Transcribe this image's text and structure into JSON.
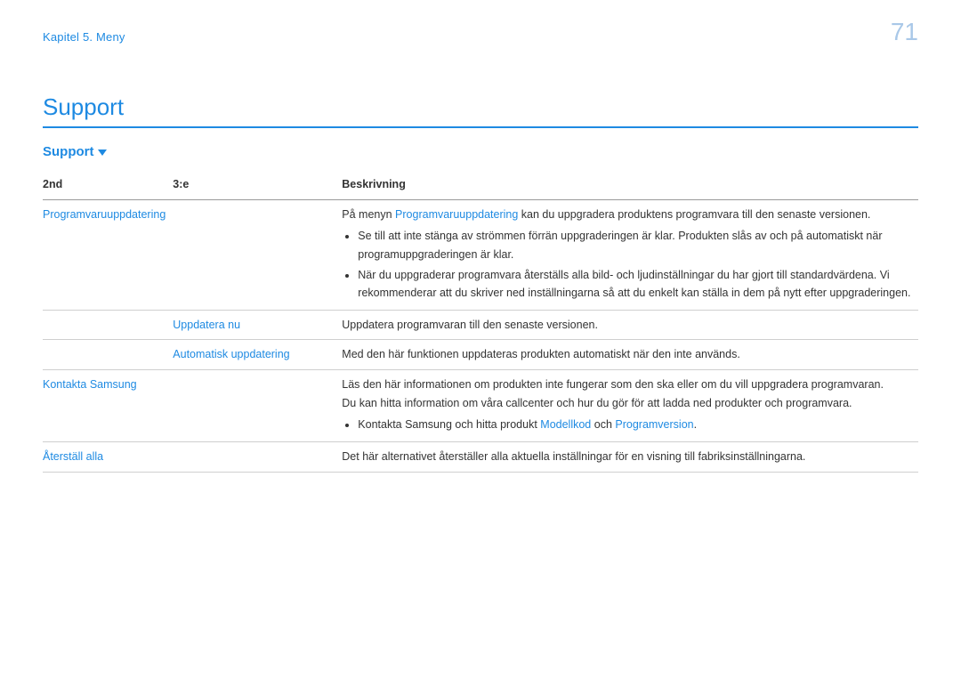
{
  "page_number": "71",
  "breadcrumb": "Kapitel 5. Meny",
  "title": "Support",
  "subtitle": "Support",
  "table": {
    "headers": {
      "c1": "2nd",
      "c2": "3:e",
      "c3": "Beskrivning"
    },
    "rows": {
      "r1": {
        "c1": "Programvaruuppdatering",
        "c3_lead_a": "På menyn ",
        "c3_lead_link": "Programvaruuppdatering",
        "c3_lead_b": " kan du uppgradera produktens programvara till den senaste versionen.",
        "c3_b1": "Se till att inte stänga av strömmen förrän uppgraderingen är klar. Produkten slås av och på automatiskt när programuppgraderingen är klar.",
        "c3_b2": "När du uppgraderar programvara återställs alla bild- och ljudinställningar du har gjort till standardvärdena. Vi rekommenderar att du skriver ned inställningarna så att du enkelt kan ställa in dem på nytt efter uppgraderingen."
      },
      "r2": {
        "c2": "Uppdatera nu",
        "c3": "Uppdatera programvaran till den senaste versionen."
      },
      "r3": {
        "c2": "Automatisk uppdatering",
        "c3": "Med den här funktionen uppdateras produkten automatiskt när den inte används."
      },
      "r4": {
        "c1": "Kontakta Samsung",
        "c3_p1": "Läs den här informationen om produkten inte fungerar som den ska eller om du vill uppgradera programvaran.",
        "c3_p2": "Du kan hitta information om våra callcenter och hur du gör för att ladda ned produkter och programvara.",
        "c3_b_a": "Kontakta Samsung och hitta produkt ",
        "c3_b_link1": "Modellkod",
        "c3_b_mid": " och ",
        "c3_b_link2": "Programversion",
        "c3_b_end": "."
      },
      "r5": {
        "c1": "Återställ alla",
        "c3": "Det här alternativet återställer alla aktuella inställningar för en visning till fabriksinställningarna."
      }
    }
  }
}
